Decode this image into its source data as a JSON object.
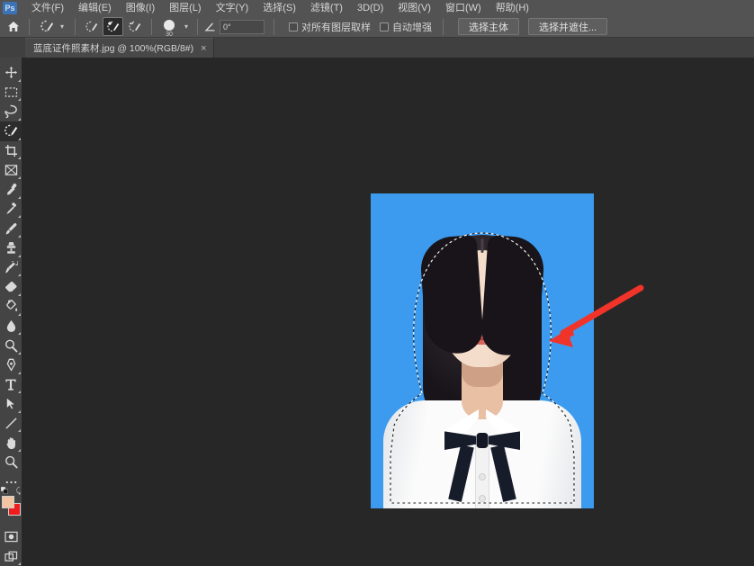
{
  "app": {
    "name": "Adobe Photoshop",
    "home_icon": "home-icon",
    "logo_text": "Ps"
  },
  "menubar": {
    "items": [
      {
        "label": "文件(F)",
        "name": "menu-file"
      },
      {
        "label": "编辑(E)",
        "name": "menu-edit"
      },
      {
        "label": "图像(I)",
        "name": "menu-image"
      },
      {
        "label": "图层(L)",
        "name": "menu-layer"
      },
      {
        "label": "文字(Y)",
        "name": "menu-type"
      },
      {
        "label": "选择(S)",
        "name": "menu-select"
      },
      {
        "label": "滤镜(T)",
        "name": "menu-filter"
      },
      {
        "label": "3D(D)",
        "name": "menu-3d"
      },
      {
        "label": "视图(V)",
        "name": "menu-view"
      },
      {
        "label": "窗口(W)",
        "name": "menu-window"
      },
      {
        "label": "帮助(H)",
        "name": "menu-help"
      }
    ]
  },
  "options_bar": {
    "tool": "quick-selection-tool",
    "preset_chevron": "▾",
    "modes": [
      {
        "name": "selection-mode-new",
        "icon": "brush-new-icon",
        "active": false
      },
      {
        "name": "selection-mode-add",
        "icon": "brush-add-icon",
        "active": true
      },
      {
        "name": "selection-mode-subtract",
        "icon": "brush-subtract-icon",
        "active": false
      }
    ],
    "brush_size": "30",
    "brush_chevron": "▾",
    "angle_icon": "angle-icon",
    "angle_value": "0°",
    "sample_all_layers": "对所有图层取样",
    "auto_enhance": "自动增强",
    "select_subject": "选择主体",
    "select_and_mask": "选择并遮住..."
  },
  "tab": {
    "title": "蓝底证件照素材.jpg @ 100%(RGB/8#)",
    "close": "×"
  },
  "toolbar": {
    "tools": [
      {
        "name": "move-tool",
        "icon": "move-icon",
        "active": false
      },
      {
        "name": "marquee-tool",
        "icon": "rectangular-marquee-icon",
        "active": false
      },
      {
        "name": "lasso-tool",
        "icon": "lasso-icon",
        "active": false
      },
      {
        "name": "quick-selection-tool",
        "icon": "quick-selection-icon",
        "active": true
      },
      {
        "name": "crop-tool",
        "icon": "crop-icon",
        "active": false
      },
      {
        "name": "frame-tool",
        "icon": "frame-icon",
        "active": false
      },
      {
        "name": "eyedropper-tool",
        "icon": "eyedropper-icon",
        "active": false
      },
      {
        "name": "healing-brush-tool",
        "icon": "healing-brush-icon",
        "active": false
      },
      {
        "name": "brush-tool",
        "icon": "brush-icon",
        "active": false
      },
      {
        "name": "clone-stamp-tool",
        "icon": "clone-stamp-icon",
        "active": false
      },
      {
        "name": "history-brush-tool",
        "icon": "history-brush-icon",
        "active": false
      },
      {
        "name": "eraser-tool",
        "icon": "eraser-icon",
        "active": false
      },
      {
        "name": "paint-bucket-tool",
        "icon": "paint-bucket-icon",
        "active": false
      },
      {
        "name": "blur-tool",
        "icon": "blur-droplet-icon",
        "active": false
      },
      {
        "name": "dodge-tool",
        "icon": "dodge-icon",
        "active": false
      },
      {
        "name": "pen-tool",
        "icon": "pen-icon",
        "active": false
      },
      {
        "name": "type-tool",
        "icon": "type-t-icon",
        "active": false
      },
      {
        "name": "path-selection-tool",
        "icon": "path-arrow-icon",
        "active": false
      },
      {
        "name": "line-tool",
        "icon": "line-icon",
        "active": false
      },
      {
        "name": "hand-tool",
        "icon": "hand-icon",
        "active": false
      },
      {
        "name": "zoom-tool",
        "icon": "magnifier-icon",
        "active": false
      },
      {
        "name": "edit-toolbar",
        "icon": "ellipsis-icon",
        "active": false
      }
    ],
    "foreground_color": "#f3c4a2",
    "background_color": "#ee1c1c",
    "swap_icon": "swap-colors-icon",
    "default_colors_icon": "default-colors-icon",
    "quick_mask": {
      "name": "quick-mask-button",
      "icon": "quick-mask-icon"
    },
    "screen_mode": {
      "name": "screen-mode-button",
      "icon": "screen-mode-icon"
    }
  },
  "canvas": {
    "background_color": "#272727",
    "document": {
      "photo_background_color": "#3d9bef",
      "zoom": "100%",
      "selection_active": true,
      "selection_type": "marching-ants",
      "annotation": {
        "type": "arrow",
        "color": "#f0342a",
        "from": "710,318",
        "to": "616,375"
      }
    }
  }
}
